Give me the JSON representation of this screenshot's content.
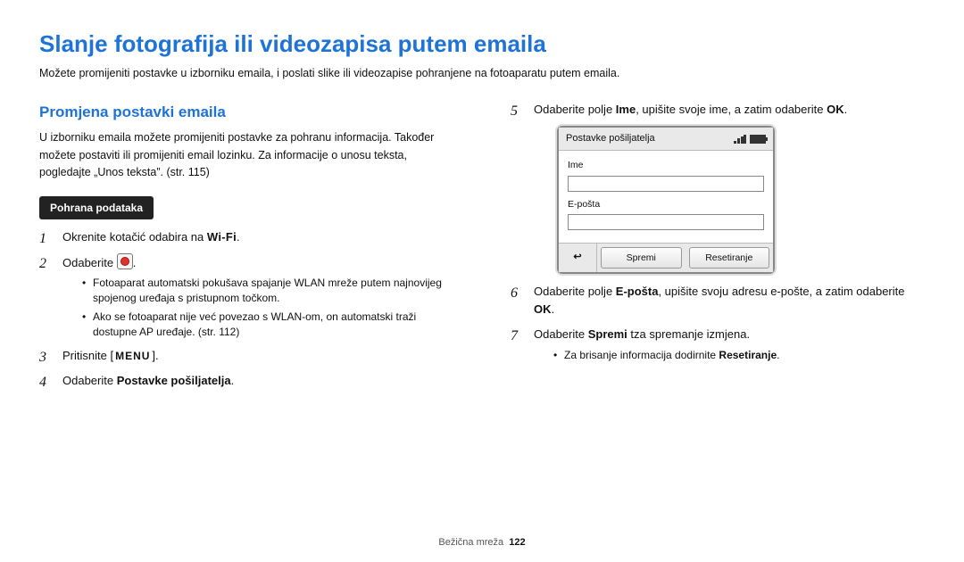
{
  "title": "Slanje fotografija ili videozapisa putem emaila",
  "intro": "Možete promijeniti postavke u izborniku emaila, i poslati slike ili videozapise pohranjene na fotoaparatu putem emaila.",
  "left": {
    "section_title": "Promjena postavki emaila",
    "section_desc": "U izborniku emaila možete promijeniti postavke za pohranu informacija. Također možete postaviti ili promijeniti email lozinku. Za informacije o unosu teksta, pogledajte „Unos teksta”. (str. 115)",
    "badge": "Pohrana podataka",
    "step1_pre": "Okrenite kotačić odabira na ",
    "step1_wifi": "Wi-Fi",
    "step1_post": ".",
    "step2_pre": "Odaberite ",
    "step2_post": ".",
    "step2_sub1": "Fotoaparat automatski pokušava spajanje WLAN mreže putem najnovijeg spojenog uređaja s pristupnom točkom.",
    "step2_sub2": "Ako se fotoaparat nije već povezao s WLAN-om, on automatski traži dostupne AP uređaje. (str. 112)",
    "step3_pre": "Pritisnite [",
    "step3_menu": "MENU",
    "step3_post": "].",
    "step4_pre": "Odaberite ",
    "step4_bold": "Postavke pošiljatelja",
    "step4_post": "."
  },
  "right": {
    "step5_pre": "Odaberite polje ",
    "step5_b1": "Ime",
    "step5_mid": ", upišite svoje ime, a zatim odaberite ",
    "step5_b2": "OK",
    "step5_post": ".",
    "device": {
      "header": "Postavke pošiljatelja",
      "ime": "Ime",
      "eposta": "E-pošta",
      "back": "↩",
      "save": "Spremi",
      "reset": "Resetiranje"
    },
    "step6_pre": "Odaberite polje ",
    "step6_b1": "E-pošta",
    "step6_mid": ", upišite svoju adresu e-pošte, a zatim odaberite ",
    "step6_b2": "OK",
    "step6_post": ".",
    "step7_pre": "Odaberite ",
    "step7_b1": "Spremi",
    "step7_post": " tza spremanje izmjena.",
    "step7_sub_pre": "Za brisanje informacija dodirnite ",
    "step7_sub_b": "Resetiranje",
    "step7_sub_post": "."
  },
  "footer": {
    "label": "Bežična mreža",
    "page": "122"
  }
}
